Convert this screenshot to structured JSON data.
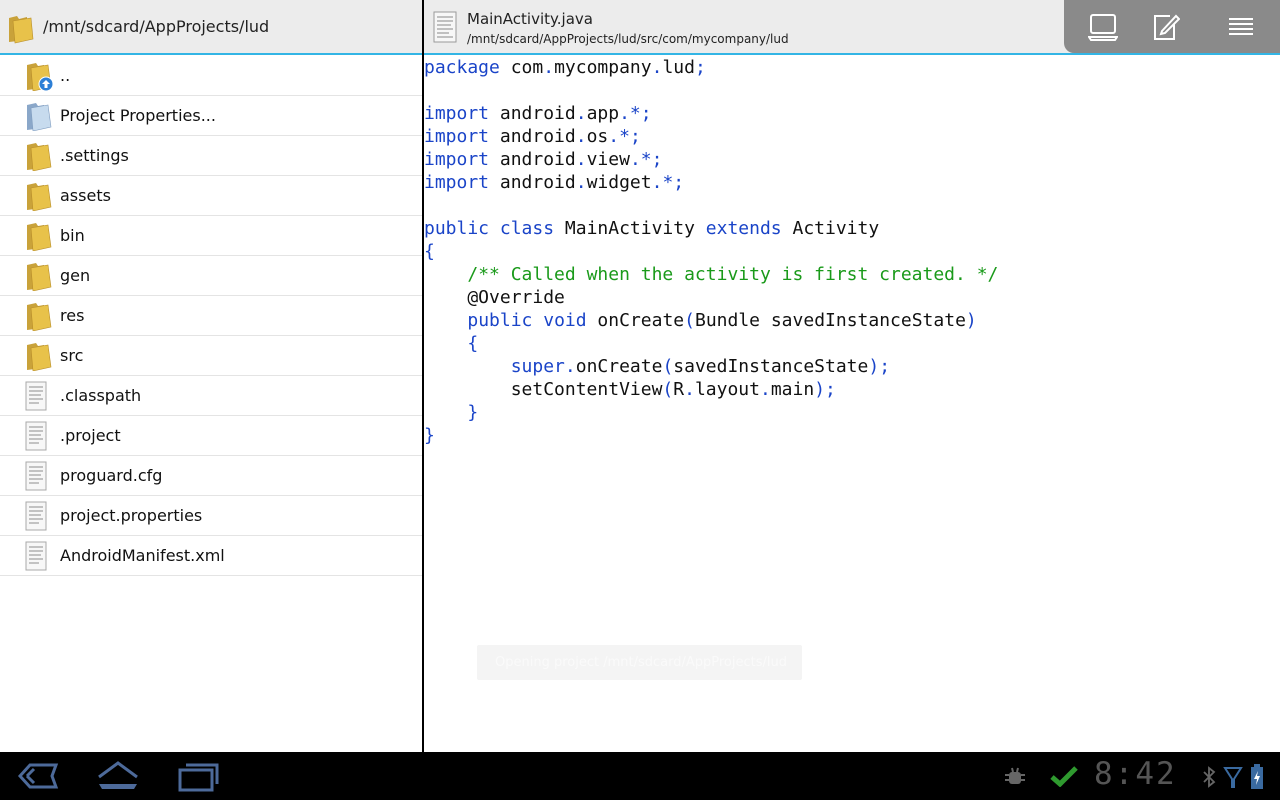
{
  "left_panel": {
    "path": "/mnt/sdcard/AppProjects/lud",
    "items": [
      {
        "label": "..",
        "icon": "folder-up-icon"
      },
      {
        "label": "Project Properties...",
        "icon": "project-properties-icon"
      },
      {
        "label": ".settings",
        "icon": "folder-icon"
      },
      {
        "label": "assets",
        "icon": "folder-icon"
      },
      {
        "label": "bin",
        "icon": "folder-icon"
      },
      {
        "label": "gen",
        "icon": "folder-icon"
      },
      {
        "label": "res",
        "icon": "folder-icon"
      },
      {
        "label": "src",
        "icon": "folder-icon"
      },
      {
        "label": ".classpath",
        "icon": "file-icon"
      },
      {
        "label": ".project",
        "icon": "file-icon"
      },
      {
        "label": "proguard.cfg",
        "icon": "file-icon"
      },
      {
        "label": "project.properties",
        "icon": "file-icon"
      },
      {
        "label": "AndroidManifest.xml",
        "icon": "file-icon"
      }
    ]
  },
  "editor": {
    "filename": "MainActivity.java",
    "filepath": "/mnt/sdcard/AppProjects/lud/src/com/mycompany/lud",
    "actions": [
      "build-icon",
      "edit-icon",
      "menu-icon"
    ],
    "code": [
      [
        [
          "kw",
          "package"
        ],
        [
          "t",
          " com"
        ],
        [
          "pu",
          "."
        ],
        [
          "t",
          "mycompany"
        ],
        [
          "pu",
          "."
        ],
        [
          "t",
          "lud"
        ],
        [
          "pu",
          ";"
        ]
      ],
      [],
      [
        [
          "kw",
          "import"
        ],
        [
          "t",
          " android"
        ],
        [
          "pu",
          "."
        ],
        [
          "t",
          "app"
        ],
        [
          "pu",
          ".*;"
        ]
      ],
      [
        [
          "kw",
          "import"
        ],
        [
          "t",
          " android"
        ],
        [
          "pu",
          "."
        ],
        [
          "t",
          "os"
        ],
        [
          "pu",
          ".*;"
        ]
      ],
      [
        [
          "kw",
          "import"
        ],
        [
          "t",
          " android"
        ],
        [
          "pu",
          "."
        ],
        [
          "t",
          "view"
        ],
        [
          "pu",
          ".*;"
        ]
      ],
      [
        [
          "kw",
          "import"
        ],
        [
          "t",
          " android"
        ],
        [
          "pu",
          "."
        ],
        [
          "t",
          "widget"
        ],
        [
          "pu",
          ".*;"
        ]
      ],
      [],
      [
        [
          "kw",
          "public"
        ],
        [
          "t",
          " "
        ],
        [
          "kw",
          "class"
        ],
        [
          "t",
          " MainActivity "
        ],
        [
          "kw",
          "extends"
        ],
        [
          "t",
          " Activity"
        ]
      ],
      [
        [
          "pu",
          "{"
        ]
      ],
      [
        [
          "t",
          "    "
        ],
        [
          "cm",
          "/** Called when the activity is first created. */"
        ]
      ],
      [
        [
          "t",
          "    @Override"
        ]
      ],
      [
        [
          "t",
          "    "
        ],
        [
          "kw",
          "public"
        ],
        [
          "t",
          " "
        ],
        [
          "kw",
          "void"
        ],
        [
          "t",
          " onCreate"
        ],
        [
          "pu",
          "("
        ],
        [
          "t",
          "Bundle savedInstanceState"
        ],
        [
          "pu",
          ")"
        ]
      ],
      [
        [
          "t",
          "    "
        ],
        [
          "pu",
          "{"
        ]
      ],
      [
        [
          "t",
          "        "
        ],
        [
          "kw",
          "super"
        ],
        [
          "pu",
          "."
        ],
        [
          "t",
          "onCreate"
        ],
        [
          "pu",
          "("
        ],
        [
          "t",
          "savedInstanceState"
        ],
        [
          "pu",
          ");"
        ]
      ],
      [
        [
          "t",
          "        setContentView"
        ],
        [
          "pu",
          "("
        ],
        [
          "t",
          "R"
        ],
        [
          "pu",
          "."
        ],
        [
          "t",
          "layout"
        ],
        [
          "pu",
          "."
        ],
        [
          "t",
          "main"
        ],
        [
          "pu",
          ");"
        ]
      ],
      [
        [
          "t",
          "    "
        ],
        [
          "pu",
          "}"
        ]
      ],
      [
        [
          "pu",
          "}"
        ]
      ]
    ]
  },
  "toast": {
    "text": "Opening project /mnt/sdcard/AppProjects/lud"
  },
  "status_bar": {
    "time": "8:42",
    "nav": [
      "back-icon",
      "home-icon",
      "recent-apps-icon"
    ],
    "indicators": [
      "usb-debug-icon",
      "checkmark-icon",
      "bluetooth-icon",
      "signal-icon",
      "battery-icon"
    ]
  },
  "colors": {
    "accent": "#33b5e5",
    "keyword": "#1a44c8",
    "comment": "#1a9a1a",
    "folder": "#e8c24a"
  }
}
